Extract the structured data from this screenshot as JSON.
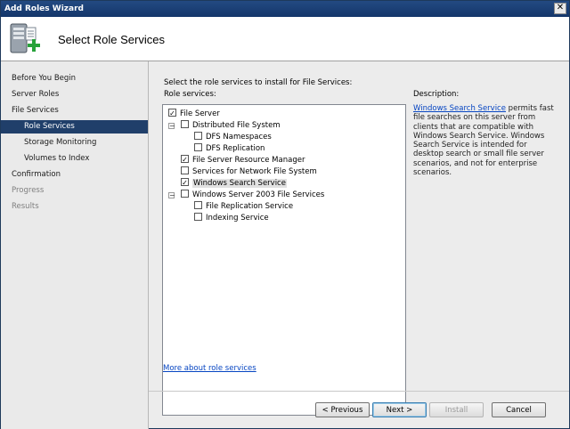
{
  "window": {
    "title": "Add Roles Wizard",
    "close_glyph": "✕"
  },
  "header": {
    "heading": "Select Role Services",
    "icon": "server-add-icon"
  },
  "nav": {
    "items": [
      {
        "label": "Before You Begin",
        "state": "normal"
      },
      {
        "label": "Server Roles",
        "state": "normal"
      },
      {
        "label": "File Services",
        "state": "normal"
      },
      {
        "label": "Role Services",
        "state": "active"
      },
      {
        "label": "Storage Monitoring",
        "state": "normal"
      },
      {
        "label": "Volumes to Index",
        "state": "normal"
      },
      {
        "label": "Confirmation",
        "state": "normal"
      },
      {
        "label": "Progress",
        "state": "disabled"
      },
      {
        "label": "Results",
        "state": "disabled"
      }
    ]
  },
  "content": {
    "instruction": "Select the role services to install for File Services:",
    "role_services_label": "Role services:",
    "description_label": "Description:",
    "description_link": "Windows Search Service",
    "description_text": " permits fast file searches on this server from clients that are compatible with Windows Search Service. Windows Search Service is intended for desktop search or small file server scenarios, and not for enterprise scenarios.",
    "more_link": "More about role services",
    "tree": [
      {
        "label": "File Server",
        "checked": true
      },
      {
        "label": "Distributed File System",
        "checked": false,
        "expander": "−"
      },
      {
        "label": "DFS Namespaces",
        "checked": false
      },
      {
        "label": "DFS Replication",
        "checked": false
      },
      {
        "label": "File Server Resource Manager",
        "checked": true
      },
      {
        "label": "Services for Network File System",
        "checked": false
      },
      {
        "label": "Windows Search Service",
        "checked": true,
        "selected": true
      },
      {
        "label": "Windows Server 2003 File Services",
        "checked": false,
        "expander": "−"
      },
      {
        "label": "File Replication Service",
        "checked": false
      },
      {
        "label": "Indexing Service",
        "checked": false
      }
    ]
  },
  "buttons": {
    "previous": "< Previous",
    "next": "Next >",
    "install": "Install",
    "cancel": "Cancel"
  },
  "colors": {
    "nav_active": "#203f6a",
    "link": "#0645c2",
    "titlebar": "#1b3f74"
  }
}
